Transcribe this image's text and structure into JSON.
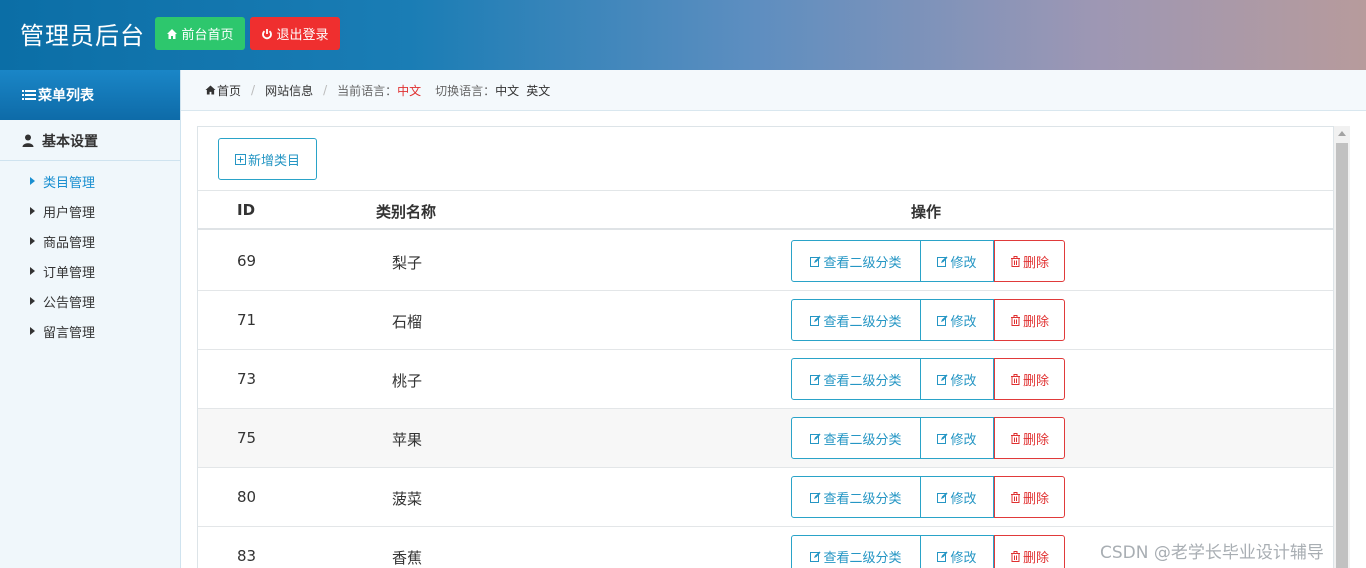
{
  "header": {
    "title": "管理员后台",
    "home_label": "前台首页",
    "logout_label": "退出登录",
    "home_color": "#2dc76d",
    "logout_color": "#ef2f2f"
  },
  "sidebar": {
    "menu_title": "菜单列表",
    "group_label": "基本设置",
    "items": [
      {
        "label": "类目管理",
        "active": true
      },
      {
        "label": "用户管理",
        "active": false
      },
      {
        "label": "商品管理",
        "active": false
      },
      {
        "label": "订单管理",
        "active": false
      },
      {
        "label": "公告管理",
        "active": false
      },
      {
        "label": "留言管理",
        "active": false
      }
    ]
  },
  "breadcrumb": {
    "home": "首页",
    "site_info": "网站信息",
    "current_lang_label": "当前语言：",
    "current_lang_value": "中文",
    "switch_lang_label": "切换语言：",
    "lang_cn": "中文",
    "lang_en": "英文"
  },
  "toolbar": {
    "add_label": "新增类目"
  },
  "table": {
    "columns": [
      "ID",
      "类别名称",
      "操作"
    ],
    "actions": {
      "view": "查看二级分类",
      "edit": "修改",
      "delete": "删除"
    },
    "rows": [
      {
        "id": "69",
        "name": "梨子"
      },
      {
        "id": "71",
        "name": "石榴"
      },
      {
        "id": "73",
        "name": "桃子"
      },
      {
        "id": "75",
        "name": "苹果"
      },
      {
        "id": "80",
        "name": "菠菜"
      },
      {
        "id": "83",
        "name": "香蕉"
      }
    ]
  },
  "watermark": "CSDN @老学长毕业设计辅导"
}
